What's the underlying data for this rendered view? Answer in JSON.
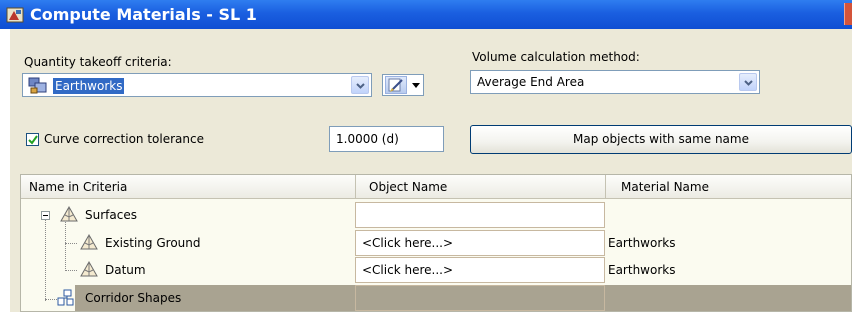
{
  "window": {
    "title": "Compute Materials - SL 1"
  },
  "criteria": {
    "label": "Quantity takeoff criteria:",
    "selected": "Earthworks"
  },
  "volume_method": {
    "label": "Volume calculation method:",
    "selected": "Average End Area"
  },
  "curve_correction": {
    "label": "Curve correction tolerance",
    "checked": true,
    "value": "1.0000 (d)"
  },
  "map_button": {
    "label": "Map objects with same name"
  },
  "grid": {
    "columns": [
      "Name in Criteria",
      "Object Name",
      "Material Name"
    ],
    "rows": [
      {
        "name": "Surfaces",
        "object": "",
        "material": ""
      },
      {
        "name": "Existing Ground",
        "object": "<Click here...>",
        "material": "Earthworks"
      },
      {
        "name": "Datum",
        "object": "<Click here...>",
        "material": "Earthworks"
      },
      {
        "name": "Corridor Shapes",
        "object": "",
        "material": ""
      }
    ]
  },
  "colors": {
    "titlebar": "#1a5fe0",
    "selection": "#316ac5",
    "dialog": "#ece9d8"
  }
}
